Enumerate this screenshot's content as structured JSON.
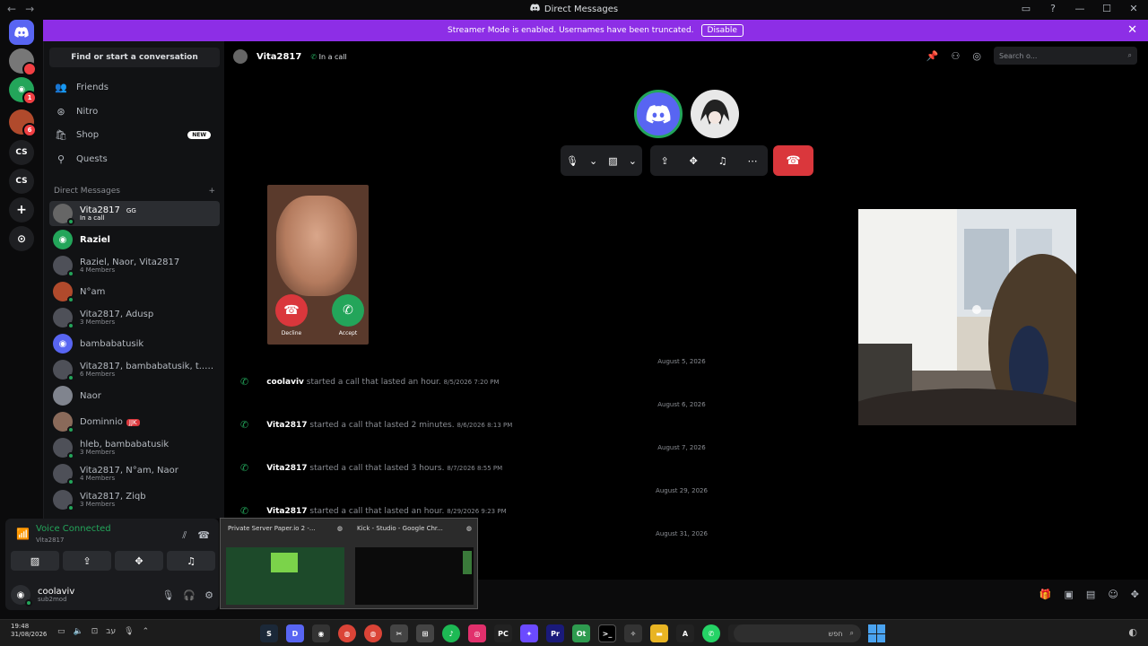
{
  "window": {
    "title": "Direct Messages",
    "back": "←",
    "forward": "→"
  },
  "banner": {
    "text": "Streamer Mode is enabled. Usernames have been truncated.",
    "button": "Disable"
  },
  "servers": [
    "CS",
    "CS"
  ],
  "sidebar": {
    "find": "Find or start a conversation",
    "nav": [
      {
        "label": "Friends",
        "icon": "👥"
      },
      {
        "label": "Nitro",
        "icon": "⊛"
      },
      {
        "label": "Shop",
        "icon": "🛍",
        "badge": "NEW"
      },
      {
        "label": "Quests",
        "icon": "⚲"
      }
    ],
    "dm_header": "Direct Messages",
    "dm_add": "+",
    "dms": [
      {
        "name": "Vita2817",
        "sub": "In a call",
        "tag": "GG"
      },
      {
        "name": "Raziel",
        "sub": ""
      },
      {
        "name": "Raziel, Naor, Vita2817",
        "sub": "4 Members"
      },
      {
        "name": "N°am",
        "sub": ""
      },
      {
        "name": "Vita2817, Adusp",
        "sub": "3 Members"
      },
      {
        "name": "bambabatusik",
        "sub": ""
      },
      {
        "name": "Vita2817, bambabatusik, t..., Do...",
        "sub": "6 Members"
      },
      {
        "name": "Naor",
        "sub": ""
      },
      {
        "name": "Dominnio",
        "sub": "",
        "tag": "JJK"
      },
      {
        "name": "hleb, bambabatusik",
        "sub": "3 Members"
      },
      {
        "name": "Vita2817, N°am, Naor",
        "sub": "4 Members"
      },
      {
        "name": "Vita2817, Ziqb",
        "sub": "3 Members"
      }
    ]
  },
  "voice": {
    "status": "Voice Connected",
    "channel": "Vita2817"
  },
  "user": {
    "name": "coolaviv",
    "status": "sub2mod"
  },
  "header": {
    "name": "Vita2817",
    "status": "In a call",
    "search_placeholder": "Search o..."
  },
  "call_card": {
    "decline": "Decline",
    "accept": "Accept"
  },
  "messages": [
    {
      "date": "August 5, 2026",
      "who": "coolaviv",
      "text": "started a call that lasted an hour.",
      "time": "8/5/2026 7:20 PM"
    },
    {
      "date": "August 6, 2026",
      "who": "Vita2817",
      "text": "started a call that lasted 2 minutes.",
      "time": "8/6/2026 8:13 PM"
    },
    {
      "date": "August 7, 2026",
      "who": "Vita2817",
      "text": "started a call that lasted 3 hours.",
      "time": "8/7/2026 8:55 PM"
    },
    {
      "date": "August 29, 2026",
      "who": "Vita2817",
      "text": "started a call that lasted an hour.",
      "time": "8/29/2026 9:23 PM"
    },
    {
      "date": "August 31, 2026",
      "who": "",
      "text": "",
      "time": ""
    }
  ],
  "thumbnails": [
    {
      "title": "Private Server Paper.io 2 -..."
    },
    {
      "title": "Kick - Studio - Google Chr..."
    }
  ],
  "taskbar": {
    "time": "19:48",
    "date": "31/08/2026",
    "search": "חפש"
  },
  "colors": {
    "banner": "#8d2ee6",
    "accent": "#5865f2",
    "green": "#23a55a",
    "red": "#da373c"
  }
}
